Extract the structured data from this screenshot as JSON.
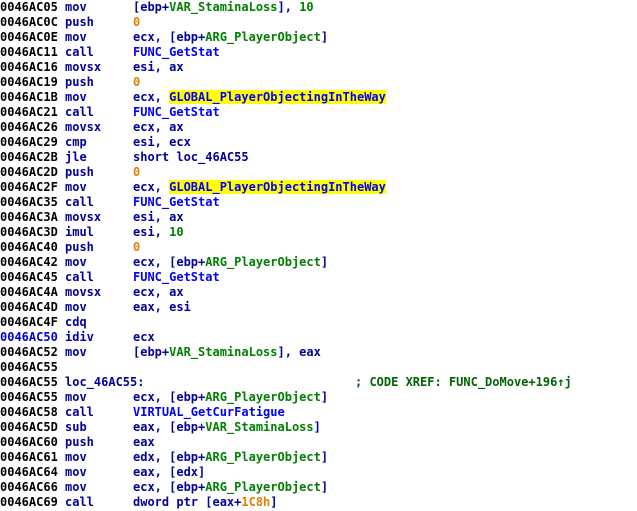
{
  "app": {
    "view": "ida-disassembly-listing",
    "title": "IDA Disassembly View"
  },
  "colors": {
    "background": "#ffffff",
    "address": "#000000",
    "address_current": "#0000d8",
    "mnemonic": "#00009c",
    "register": "#00009c",
    "immediate_orange": "#e08000",
    "immediate_green": "#008000",
    "stack_variable": "#008000",
    "call_target": "#0000ff",
    "global_symbol": "#0000ff",
    "location_label": "#00009c",
    "comment": "#006400",
    "highlight": "#ffff00"
  },
  "listing": {
    "lines": [
      {
        "address": "0046AC05",
        "current": false,
        "mnemonic": "mov",
        "operands": [
          {
            "text": "[ebp+",
            "cls": "tok-punct"
          },
          {
            "text": "VAR_StaminaLoss",
            "cls": "tok-var"
          },
          {
            "text": "], ",
            "cls": "tok-punct"
          },
          {
            "text": "10",
            "cls": "tok-num2"
          }
        ]
      },
      {
        "address": "0046AC0C",
        "current": false,
        "mnemonic": "push",
        "operands": [
          {
            "text": "0",
            "cls": "tok-num"
          }
        ]
      },
      {
        "address": "0046AC0E",
        "current": false,
        "mnemonic": "mov",
        "operands": [
          {
            "text": "ecx, [ebp+",
            "cls": "tok-reg"
          },
          {
            "text": "ARG_PlayerObject",
            "cls": "tok-var"
          },
          {
            "text": "]",
            "cls": "tok-punct"
          }
        ]
      },
      {
        "address": "0046AC11",
        "current": false,
        "mnemonic": "call",
        "operands": [
          {
            "text": "FUNC_GetStat",
            "cls": "tok-func"
          }
        ]
      },
      {
        "address": "0046AC16",
        "current": false,
        "mnemonic": "movsx",
        "operands": [
          {
            "text": "esi, ax",
            "cls": "tok-reg"
          }
        ]
      },
      {
        "address": "0046AC19",
        "current": false,
        "mnemonic": "push",
        "operands": [
          {
            "text": "0",
            "cls": "tok-num"
          }
        ]
      },
      {
        "address": "0046AC1B",
        "current": false,
        "mnemonic": "mov",
        "operands": [
          {
            "text": "ecx, ",
            "cls": "tok-reg"
          },
          {
            "text": "GLOBAL_PlayerObjectingInTheWay",
            "cls": "tok-global hl"
          }
        ]
      },
      {
        "address": "0046AC21",
        "current": false,
        "mnemonic": "call",
        "operands": [
          {
            "text": "FUNC_GetStat",
            "cls": "tok-func"
          }
        ]
      },
      {
        "address": "0046AC26",
        "current": false,
        "mnemonic": "movsx",
        "operands": [
          {
            "text": "ecx, ax",
            "cls": "tok-reg"
          }
        ]
      },
      {
        "address": "0046AC29",
        "current": false,
        "mnemonic": "cmp",
        "operands": [
          {
            "text": "esi, ecx",
            "cls": "tok-reg"
          }
        ]
      },
      {
        "address": "0046AC2B",
        "current": false,
        "mnemonic": "jle",
        "operands": [
          {
            "text": "short loc_46AC55",
            "cls": "tok-loc"
          }
        ]
      },
      {
        "address": "0046AC2D",
        "current": false,
        "mnemonic": "push",
        "operands": [
          {
            "text": "0",
            "cls": "tok-num"
          }
        ]
      },
      {
        "address": "0046AC2F",
        "current": false,
        "mnemonic": "mov",
        "operands": [
          {
            "text": "ecx, ",
            "cls": "tok-reg"
          },
          {
            "text": "GLOBAL_PlayerObjectingInTheWay",
            "cls": "tok-global hl"
          }
        ]
      },
      {
        "address": "0046AC35",
        "current": false,
        "mnemonic": "call",
        "operands": [
          {
            "text": "FUNC_GetStat",
            "cls": "tok-func"
          }
        ]
      },
      {
        "address": "0046AC3A",
        "current": false,
        "mnemonic": "movsx",
        "operands": [
          {
            "text": "esi, ax",
            "cls": "tok-reg"
          }
        ]
      },
      {
        "address": "0046AC3D",
        "current": false,
        "mnemonic": "imul",
        "operands": [
          {
            "text": "esi, ",
            "cls": "tok-reg"
          },
          {
            "text": "10",
            "cls": "tok-num2"
          }
        ]
      },
      {
        "address": "0046AC40",
        "current": false,
        "mnemonic": "push",
        "operands": [
          {
            "text": "0",
            "cls": "tok-num"
          }
        ]
      },
      {
        "address": "0046AC42",
        "current": false,
        "mnemonic": "mov",
        "operands": [
          {
            "text": "ecx, [ebp+",
            "cls": "tok-reg"
          },
          {
            "text": "ARG_PlayerObject",
            "cls": "tok-var"
          },
          {
            "text": "]",
            "cls": "tok-punct"
          }
        ]
      },
      {
        "address": "0046AC45",
        "current": false,
        "mnemonic": "call",
        "operands": [
          {
            "text": "FUNC_GetStat",
            "cls": "tok-func"
          }
        ]
      },
      {
        "address": "0046AC4A",
        "current": false,
        "mnemonic": "movsx",
        "operands": [
          {
            "text": "ecx, ax",
            "cls": "tok-reg"
          }
        ]
      },
      {
        "address": "0046AC4D",
        "current": false,
        "mnemonic": "mov",
        "operands": [
          {
            "text": "eax, esi",
            "cls": "tok-reg"
          }
        ]
      },
      {
        "address": "0046AC4F",
        "current": false,
        "mnemonic": "cdq",
        "operands": []
      },
      {
        "address": "0046AC50",
        "current": true,
        "mnemonic": "idiv",
        "operands": [
          {
            "text": "ecx",
            "cls": "tok-reg"
          }
        ]
      },
      {
        "address": "0046AC52",
        "current": false,
        "mnemonic": "mov",
        "operands": [
          {
            "text": "[ebp+",
            "cls": "tok-punct"
          },
          {
            "text": "VAR_StaminaLoss",
            "cls": "tok-var"
          },
          {
            "text": "], eax",
            "cls": "tok-reg"
          }
        ]
      },
      {
        "address": "0046AC55",
        "current": false,
        "mnemonic": "",
        "operands": []
      },
      {
        "address": "0046AC55",
        "current": false,
        "label": "loc_46AC55:",
        "comment": "; CODE XREF: FUNC_DoMove+196↑j",
        "operands": []
      },
      {
        "address": "0046AC55",
        "current": false,
        "mnemonic": "mov",
        "operands": [
          {
            "text": "ecx, [ebp+",
            "cls": "tok-reg"
          },
          {
            "text": "ARG_PlayerObject",
            "cls": "tok-var"
          },
          {
            "text": "]",
            "cls": "tok-punct"
          }
        ]
      },
      {
        "address": "0046AC58",
        "current": false,
        "mnemonic": "call",
        "operands": [
          {
            "text": "VIRTUAL_GetCurFatigue",
            "cls": "tok-func"
          }
        ]
      },
      {
        "address": "0046AC5D",
        "current": false,
        "mnemonic": "sub",
        "operands": [
          {
            "text": "eax, [ebp+",
            "cls": "tok-reg"
          },
          {
            "text": "VAR_StaminaLoss",
            "cls": "tok-var"
          },
          {
            "text": "]",
            "cls": "tok-punct"
          }
        ]
      },
      {
        "address": "0046AC60",
        "current": false,
        "mnemonic": "push",
        "operands": [
          {
            "text": "eax",
            "cls": "tok-reg"
          }
        ]
      },
      {
        "address": "0046AC61",
        "current": false,
        "mnemonic": "mov",
        "operands": [
          {
            "text": "edx, [ebp+",
            "cls": "tok-reg"
          },
          {
            "text": "ARG_PlayerObject",
            "cls": "tok-var"
          },
          {
            "text": "]",
            "cls": "tok-punct"
          }
        ]
      },
      {
        "address": "0046AC64",
        "current": false,
        "mnemonic": "mov",
        "operands": [
          {
            "text": "eax, [edx]",
            "cls": "tok-reg"
          }
        ]
      },
      {
        "address": "0046AC66",
        "current": false,
        "mnemonic": "mov",
        "operands": [
          {
            "text": "ecx, [ebp+",
            "cls": "tok-reg"
          },
          {
            "text": "ARG_PlayerObject",
            "cls": "tok-var"
          },
          {
            "text": "]",
            "cls": "tok-punct"
          }
        ]
      },
      {
        "address": "0046AC69",
        "current": false,
        "mnemonic": "call",
        "operands": [
          {
            "text": "dword ptr [eax+",
            "cls": "tok-reg"
          },
          {
            "text": "1C8h",
            "cls": "tok-num"
          },
          {
            "text": "]",
            "cls": "tok-punct"
          }
        ]
      }
    ]
  }
}
